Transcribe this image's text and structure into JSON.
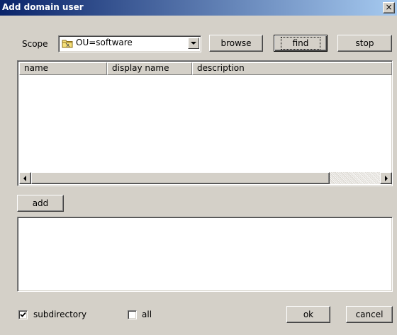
{
  "window": {
    "title": "Add domain user",
    "close_glyph": "×"
  },
  "scope": {
    "label": "Scope",
    "value": "OU=software",
    "icon": "folder-icon"
  },
  "buttons": {
    "browse": "browse",
    "find": "find",
    "stop": "stop",
    "add": "add",
    "ok": "ok",
    "cancel": "cancel"
  },
  "results_table": {
    "columns": [
      "name",
      "display name",
      "description"
    ],
    "rows": []
  },
  "selected_list": {
    "items": []
  },
  "options": {
    "subdirectory": {
      "label": "subdirectory",
      "checked": true
    },
    "all": {
      "label": "all",
      "checked": false
    }
  },
  "colors": {
    "titlebar_start": "#0a246a",
    "titlebar_end": "#a6caf0",
    "face": "#d4d0c8"
  }
}
